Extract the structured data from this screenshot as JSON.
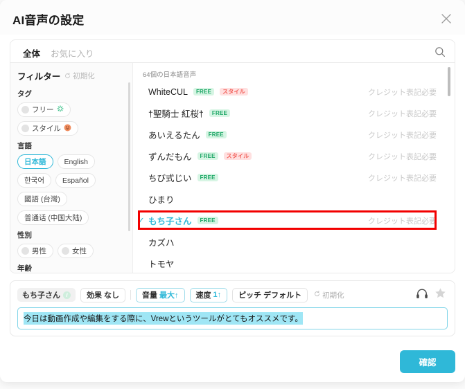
{
  "dialog": {
    "title": "AI音声の設定",
    "close_icon": "close-icon"
  },
  "search": {
    "tab_all": "全体",
    "tab_favorites": "お気に入り",
    "search_icon": "search-icon"
  },
  "sidebar": {
    "filter_title": "フィルター",
    "reset_label": "初期化",
    "groups": [
      {
        "label": "タグ",
        "options": [
          {
            "label": "フリー",
            "emoji": "✴",
            "selected": false,
            "toggle": true
          },
          {
            "label": "スタイル",
            "emoji": "😀",
            "selected": false,
            "toggle": true
          }
        ]
      },
      {
        "label": "言語",
        "options": [
          {
            "label": "日本語",
            "selected": true,
            "toggle": false
          },
          {
            "label": "English",
            "selected": false,
            "toggle": false
          },
          {
            "label": "한국어",
            "selected": false,
            "toggle": false
          },
          {
            "label": "Español",
            "selected": false,
            "toggle": false
          },
          {
            "label": "國語 (台灣)",
            "selected": false,
            "toggle": false
          },
          {
            "label": "普通话 (中国大陆)",
            "selected": false,
            "toggle": false
          }
        ]
      },
      {
        "label": "性別",
        "options": [
          {
            "label": "男性",
            "selected": false,
            "toggle": true
          },
          {
            "label": "女性",
            "selected": false,
            "toggle": true
          }
        ]
      },
      {
        "label": "年齢",
        "options": []
      }
    ]
  },
  "list": {
    "count_label": "64個の日本語音声",
    "credit_label": "クレジット表記必要",
    "rows": [
      {
        "name": "WhiteCUL",
        "badges": [
          "FREE",
          "スタイル"
        ],
        "credit": true,
        "selected": false
      },
      {
        "name": "†聖騎士 紅桜†",
        "badges": [
          "FREE"
        ],
        "credit": true,
        "selected": false
      },
      {
        "name": "あいえるたん",
        "badges": [
          "FREE"
        ],
        "credit": true,
        "selected": false
      },
      {
        "name": "ずんだもん",
        "badges": [
          "FREE",
          "スタイル"
        ],
        "credit": true,
        "selected": false
      },
      {
        "name": "ちび式じい",
        "badges": [
          "FREE"
        ],
        "credit": true,
        "selected": false
      },
      {
        "name": "ひまり",
        "badges": [],
        "credit": false,
        "selected": false
      },
      {
        "name": "もち子さん",
        "badges": [
          "FREE"
        ],
        "credit": true,
        "selected": true
      },
      {
        "name": "カズハ",
        "badges": [],
        "credit": false,
        "selected": false
      },
      {
        "name": "トモヤ",
        "badges": [],
        "credit": false,
        "selected": false
      }
    ]
  },
  "toolbar": {
    "voice_name": "もち子さん",
    "effect_label": "効果",
    "effect_value": "なし",
    "volume_label": "音量",
    "volume_value": "最大↑",
    "speed_label": "速度",
    "speed_value": "1↑",
    "pitch_label": "ピッチ",
    "pitch_value": "デフォルト",
    "reset_label": "初期化",
    "headphone_icon": "headphone-icon",
    "star_icon": "star-icon"
  },
  "text_input": {
    "value": "今日は動画作成や編集をする際に、Vrewというツールがとてもオススメです。"
  },
  "footer": {
    "confirm_label": "確認"
  },
  "colors": {
    "accent": "#2fb8d8",
    "free_badge_bg": "#d7f5e4",
    "free_badge_text": "#1aa564",
    "style_badge_bg": "#ffe0e0",
    "style_badge_text": "#f2625c",
    "annotation": "#f20000"
  }
}
